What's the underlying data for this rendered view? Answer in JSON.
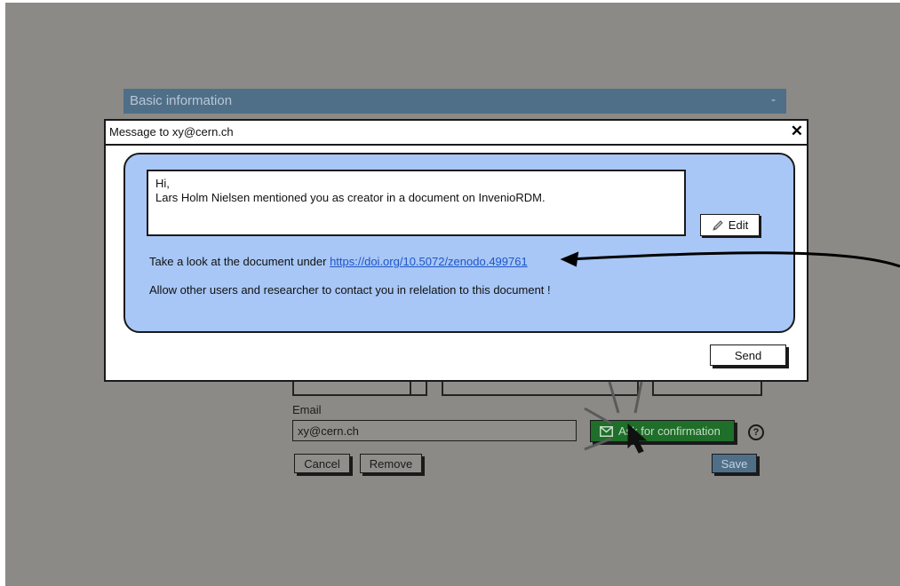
{
  "section": {
    "title": "Basic information",
    "collapse_symbol": "-"
  },
  "form": {
    "email_label": "Email",
    "email_value": "xy@cern.ch",
    "ask_button": "Ask for confirmation",
    "cancel_button": "Cancel",
    "remove_button": "Remove",
    "save_button": "Save",
    "help_symbol": "?"
  },
  "modal": {
    "title": "Message to xy@cern.ch",
    "close_symbol": "✕",
    "message_line1": "Hi,",
    "message_line2": "Lars Holm Nielsen mentioned you as creator in a document on InvenioRDM.",
    "edit_button": "Edit",
    "doc_prefix": "Take a look at the document under ",
    "doc_link": "https://doi.org/10.5072/zenodo.499761",
    "allow_text": "Allow other users and researcher to contact you in relelation to this document !",
    "send_button": "Send"
  },
  "icons": [
    "close-icon",
    "pencil-icon",
    "envelope-icon",
    "help-icon",
    "cursor-icon",
    "arrow-annotation"
  ],
  "colors": {
    "backdrop": "#8b8a87",
    "panel": "#a8c7f6",
    "header": "#4f6f89",
    "confirm": "#1f6e29",
    "link": "#1e56c8"
  }
}
